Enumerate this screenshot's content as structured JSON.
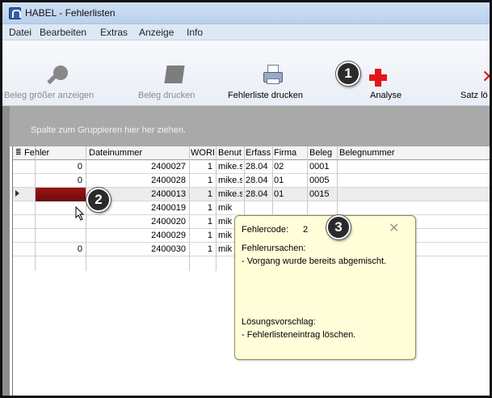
{
  "window": {
    "title": "HABEL - Fehlerlisten"
  },
  "menu": [
    "Datei",
    "Bearbeiten",
    "Extras",
    "Anzeige",
    "Info"
  ],
  "toolbar": {
    "beleg_groesser": "Beleg größer anzeigen",
    "beleg_drucken": "Beleg drucken",
    "fehlerliste_drucken": "Fehlerliste drucken",
    "analyse": "Analyse",
    "satz": "Satz lö"
  },
  "group_panel": {
    "hint": "Spalte zum Gruppieren hier her ziehen."
  },
  "grid": {
    "columns": [
      "Fehler",
      "Dateinummer",
      "WORI",
      "Benut",
      "Erfass",
      "Firma",
      "Beleg",
      "Belegnummer"
    ],
    "rows": [
      {
        "fehler": "0",
        "dateinummer": "2400027",
        "wori": "1",
        "benut": "mike.s",
        "erfass": "28.04",
        "firma": "02",
        "beleg": "0001"
      },
      {
        "fehler": "0",
        "dateinummer": "2400028",
        "wori": "1",
        "benut": "mike.s",
        "erfass": "28.04",
        "firma": "01",
        "beleg": "0005"
      },
      {
        "fehler": "",
        "dateinummer": "2400013",
        "wori": "1",
        "benut": "mike.s",
        "erfass": "28.04",
        "firma": "01",
        "beleg": "0015"
      },
      {
        "fehler": "",
        "dateinummer": "2400019",
        "wori": "1",
        "benut": "mik",
        "erfass": "",
        "firma": "",
        "beleg": ""
      },
      {
        "fehler": "",
        "dateinummer": "2400020",
        "wori": "1",
        "benut": "mik",
        "erfass": "",
        "firma": "",
        "beleg": ""
      },
      {
        "fehler": "",
        "dateinummer": "2400029",
        "wori": "1",
        "benut": "mik",
        "erfass": "",
        "firma": "",
        "beleg": ""
      },
      {
        "fehler": "0",
        "dateinummer": "2400030",
        "wori": "1",
        "benut": "mik",
        "erfass": "",
        "firma": "",
        "beleg": ""
      }
    ]
  },
  "tooltip": {
    "fehlercode_label": "Fehlercode:",
    "fehlercode_value": "2",
    "ursachen_label": "Fehlerursachen:",
    "ursachen_text": "- Vorgang wurde bereits abgemischt.",
    "loesung_label": "Lösungsvorschlag:",
    "loesung_text": "- Fehlerlisteneintrag löschen."
  },
  "badges": [
    "1",
    "2",
    "3"
  ],
  "colors": {
    "selected_cell": "#8b1010",
    "accent_red": "#e3151a",
    "tooltip_bg": "#fffed8"
  }
}
